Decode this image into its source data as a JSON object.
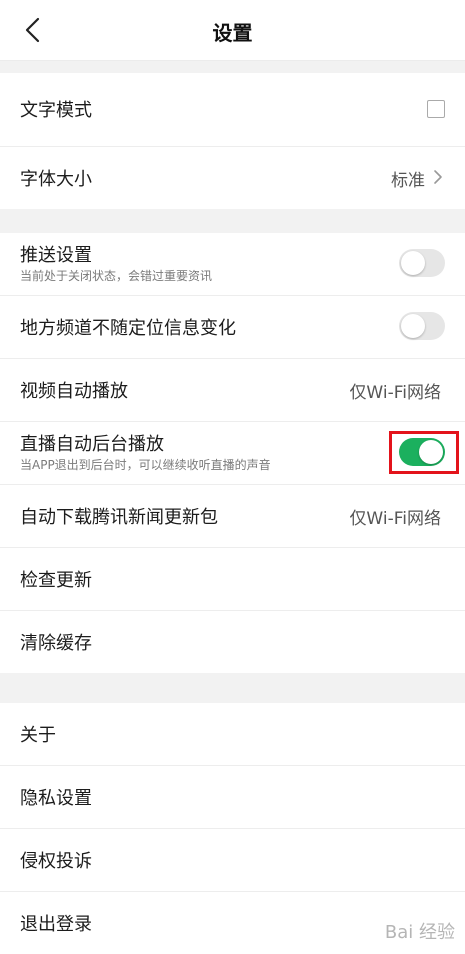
{
  "header": {
    "title": "设置"
  },
  "section1": {
    "text_mode": "文字模式",
    "font_size": "字体大小",
    "font_size_value": "标准"
  },
  "section2": {
    "push_settings": "推送设置",
    "push_sub": "当前处于关闭状态，会错过重要资讯",
    "local_channel": "地方频道不随定位信息变化",
    "video_autoplay": "视频自动播放",
    "video_autoplay_value": "仅Wi-Fi网络",
    "live_background": "直播自动后台播放",
    "live_background_sub": "当APP退出到后台时，可以继续收听直播的声音",
    "auto_download": "自动下载腾讯新闻更新包",
    "auto_download_value": "仅Wi-Fi网络",
    "check_update": "检查更新",
    "clear_cache": "清除缓存"
  },
  "section3": {
    "about": "关于",
    "privacy": "隐私设置",
    "complaint": "侵权投诉",
    "logout": "退出登录"
  },
  "toggles": {
    "push": false,
    "local_channel": false,
    "live_background": true
  },
  "colors": {
    "toggle_on": "#1bb05e",
    "highlight": "#e3131b"
  },
  "watermark": "Bai 经验"
}
